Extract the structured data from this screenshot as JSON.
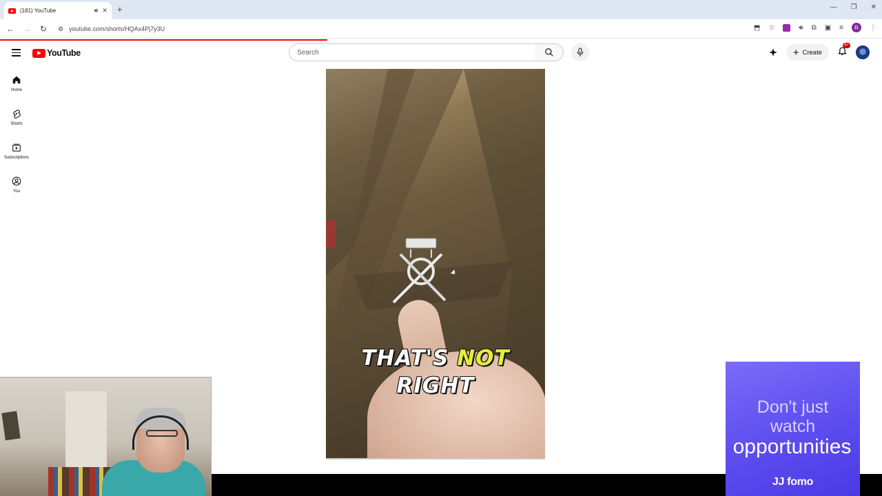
{
  "browser": {
    "tab_title": "(181) YouTube",
    "new_tab": "+",
    "url": "youtube.com/shorts/HQAx4Pj7y3U",
    "profile_initial": "R",
    "win_min": "—",
    "win_restore": "❐",
    "win_close": "✕"
  },
  "masthead": {
    "logo_text": "YouTube",
    "search_placeholder": "Search",
    "create_label": "Create",
    "notifications_badge": "9+"
  },
  "guide": {
    "items": [
      {
        "label": "Home",
        "icon": "home-icon"
      },
      {
        "label": "Shorts",
        "icon": "shorts-icon"
      },
      {
        "label": "Subscriptions",
        "icon": "subscriptions-icon"
      },
      {
        "label": "You",
        "icon": "you-icon"
      }
    ]
  },
  "short": {
    "caption_line1_a": "THAT'S",
    "caption_line1_b": "NOT",
    "caption_line2": "RIGHT",
    "caption_highlight_color": "#e3ee3b"
  },
  "ad": {
    "line1": "Don't just",
    "line2": "watch",
    "line3": "opportunities",
    "brand": "fomo",
    "brand_mark": "JJ"
  },
  "colors": {
    "youtube_red": "#ff0000",
    "ad_purple": "#5f4ff0"
  }
}
